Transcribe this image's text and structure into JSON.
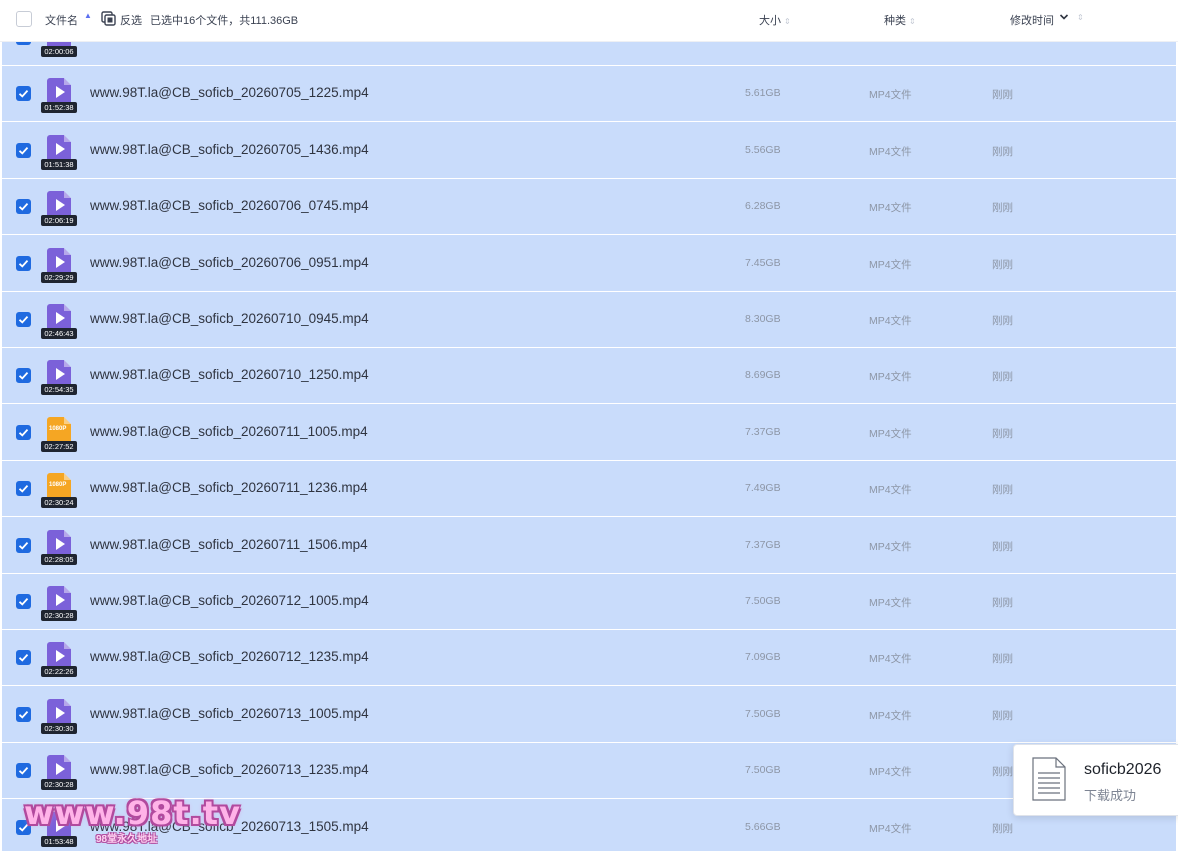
{
  "header": {
    "name_label": "文件名",
    "invert_label": "反选",
    "summary": "已选中16个文件，共111.36GB",
    "size_label": "大小",
    "type_label": "种类",
    "time_label": "修改时间"
  },
  "rows": [
    {
      "name": "",
      "duration": "02:00:06",
      "size": "",
      "type": "",
      "time": "",
      "icon": "purple"
    },
    {
      "name": "www.98T.la@CB_soficb_20260705_1225.mp4",
      "duration": "01:52:38",
      "size": "5.61GB",
      "type": "MP4文件",
      "time": "刚刚",
      "icon": "purple"
    },
    {
      "name": "www.98T.la@CB_soficb_20260705_1436.mp4",
      "duration": "01:51:38",
      "size": "5.56GB",
      "type": "MP4文件",
      "time": "刚刚",
      "icon": "purple"
    },
    {
      "name": "www.98T.la@CB_soficb_20260706_0745.mp4",
      "duration": "02:06:19",
      "size": "6.28GB",
      "type": "MP4文件",
      "time": "刚刚",
      "icon": "purple"
    },
    {
      "name": "www.98T.la@CB_soficb_20260706_0951.mp4",
      "duration": "02:29:29",
      "size": "7.45GB",
      "type": "MP4文件",
      "time": "刚刚",
      "icon": "purple"
    },
    {
      "name": "www.98T.la@CB_soficb_20260710_0945.mp4",
      "duration": "02:46:43",
      "size": "8.30GB",
      "type": "MP4文件",
      "time": "刚刚",
      "icon": "purple"
    },
    {
      "name": "www.98T.la@CB_soficb_20260710_1250.mp4",
      "duration": "02:54:35",
      "size": "8.69GB",
      "type": "MP4文件",
      "time": "刚刚",
      "icon": "purple"
    },
    {
      "name": "www.98T.la@CB_soficb_20260711_1005.mp4",
      "duration": "02:27:52",
      "size": "7.37GB",
      "type": "MP4文件",
      "time": "刚刚",
      "icon": "orange",
      "badge": "1080P"
    },
    {
      "name": "www.98T.la@CB_soficb_20260711_1236.mp4",
      "duration": "02:30:24",
      "size": "7.49GB",
      "type": "MP4文件",
      "time": "刚刚",
      "icon": "orange",
      "badge": "1080P"
    },
    {
      "name": "www.98T.la@CB_soficb_20260711_1506.mp4",
      "duration": "02:28:05",
      "size": "7.37GB",
      "type": "MP4文件",
      "time": "刚刚",
      "icon": "purple"
    },
    {
      "name": "www.98T.la@CB_soficb_20260712_1005.mp4",
      "duration": "02:30:28",
      "size": "7.50GB",
      "type": "MP4文件",
      "time": "刚刚",
      "icon": "purple"
    },
    {
      "name": "www.98T.la@CB_soficb_20260712_1235.mp4",
      "duration": "02:22:26",
      "size": "7.09GB",
      "type": "MP4文件",
      "time": "刚刚",
      "icon": "purple"
    },
    {
      "name": "www.98T.la@CB_soficb_20260713_1005.mp4",
      "duration": "02:30:30",
      "size": "7.50GB",
      "type": "MP4文件",
      "time": "刚刚",
      "icon": "purple"
    },
    {
      "name": "www.98T.la@CB_soficb_20260713_1235.mp4",
      "duration": "02:30:28",
      "size": "7.50GB",
      "type": "MP4文件",
      "time": "刚刚",
      "icon": "purple"
    },
    {
      "name": "www.98T.la@CB_soficb_20260713_1505.mp4",
      "duration": "01:53:48",
      "size": "5.66GB",
      "type": "MP4文件",
      "time": "刚刚",
      "icon": "purple"
    }
  ],
  "toast": {
    "name": "soficb2026",
    "status": "下载成功"
  },
  "watermark": {
    "main": "www.98t.tv",
    "sub": "98堂永久地址"
  },
  "colors": {
    "selection": "#c9dcfb",
    "checkbox": "#1f6ae0",
    "purple_icon": "#7b61d9",
    "orange_icon": "#f5a623"
  }
}
